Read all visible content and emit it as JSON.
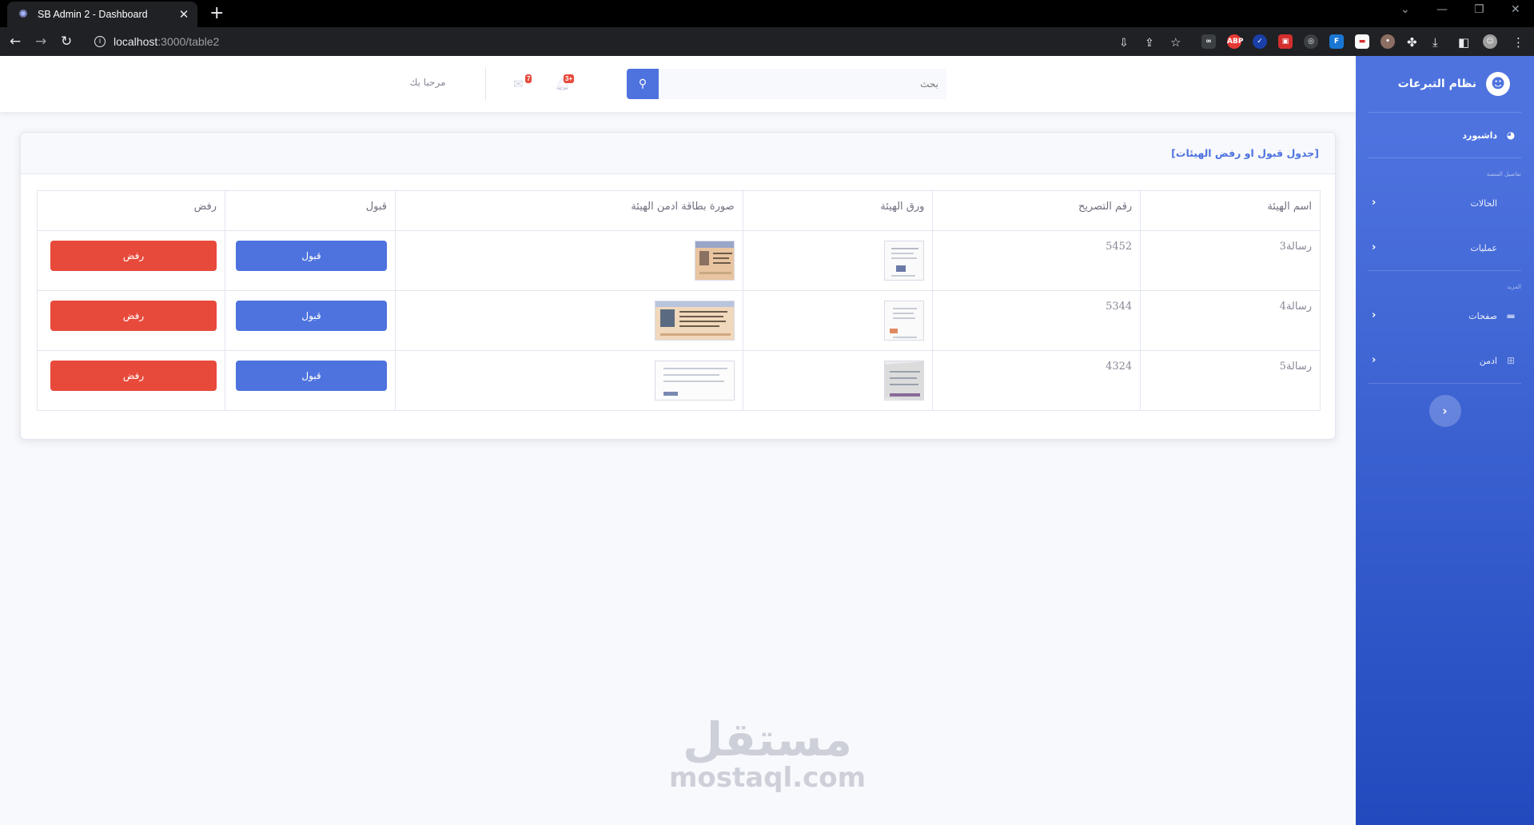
{
  "browser": {
    "tab_title": "SB Admin 2 - Dashboard",
    "url_host": "localhost",
    "url_path": ":3000/table2"
  },
  "sidebar": {
    "brand": "نظام التبرعات",
    "items": [
      {
        "label": "داشبورد",
        "icon": "tachometer-icon",
        "active": true
      },
      {
        "heading": "تفاصيل المنصة"
      },
      {
        "label": "الحالات",
        "icon": "",
        "has_chevron": true
      },
      {
        "label": "عمليات",
        "icon": "",
        "has_chevron": true
      },
      {
        "heading": "المزيد"
      },
      {
        "label": "صفحات",
        "icon": "folder-icon",
        "has_chevron": true
      },
      {
        "label": "ادمن",
        "icon": "table-icon",
        "has_chevron": true
      }
    ],
    "heading_details": "تفاصيل المنصة",
    "heading_more": "المزيد",
    "dashboard_label": "داشبورد",
    "cases_label": "الحالات",
    "operations_label": "عمليات",
    "pages_label": "صفحات",
    "admin_label": "ادمن"
  },
  "topbar": {
    "search_placeholder": "بحث",
    "alerts_count": "3+",
    "messages_count": "7",
    "welcome": "مرحبا بك"
  },
  "card": {
    "title": "[جدول قبول او رفض الهيئات]",
    "columns": [
      "اسم الهيئة",
      "رقم التصريح",
      "ورق الهيئة",
      "صورة بطاقة ادمن الهيئة",
      "قبول",
      "رفض"
    ],
    "rows": [
      {
        "name": "رسالة3",
        "permit": "5452",
        "accept": "قبول",
        "reject": "رفض"
      },
      {
        "name": "رسالة4",
        "permit": "5344",
        "accept": "قبول",
        "reject": "رفض"
      },
      {
        "name": "رسالة5",
        "permit": "4324",
        "accept": "قبول",
        "reject": "رفض"
      }
    ]
  },
  "watermark": {
    "arabic": "مستقل",
    "english": "mostaql.com"
  },
  "colors": {
    "primary": "#4e73df",
    "danger": "#e74a3b",
    "sidebar_dark": "#224abe"
  }
}
